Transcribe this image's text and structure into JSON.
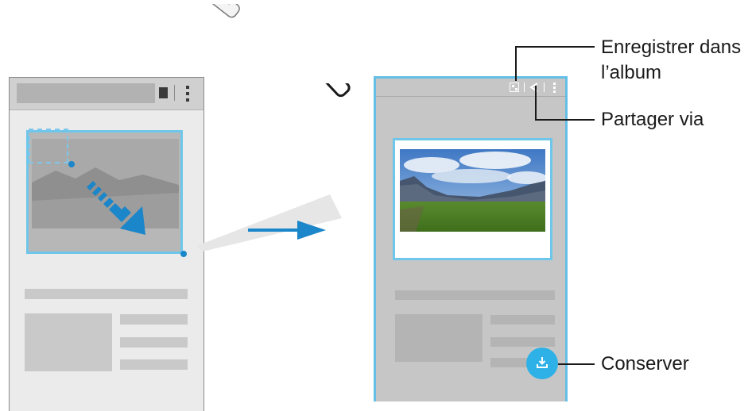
{
  "callouts": {
    "save_album_line1": "Enregistrer dans",
    "save_album_line2": "l’album",
    "share_via": "Partager via",
    "keep": "Conserver"
  },
  "icons": {
    "pen": "s-pen-stylus",
    "arrow": "transition-arrow",
    "drag": "drag-direction-arrow",
    "save": "save-to-album-icon",
    "share": "share-icon",
    "more": "more-options-icon",
    "keep": "keep-download-icon"
  },
  "colors": {
    "accent": "#2eb1e6",
    "selection": "#6ec6ea",
    "arrow": "#1b86c9"
  }
}
